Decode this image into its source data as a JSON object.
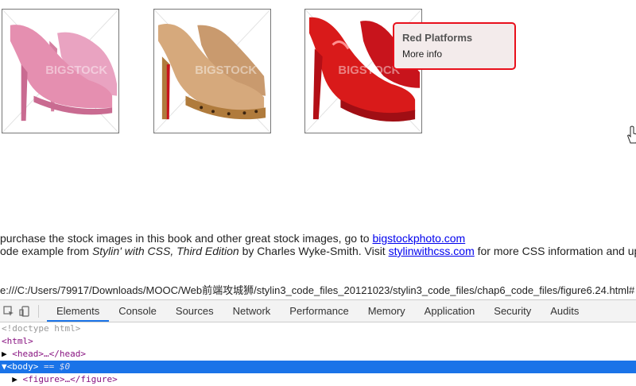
{
  "gallery": {
    "images": [
      {
        "name": "pink-glitter-heels",
        "watermark": "BIGSTOCK",
        "color": "#e58fb0"
      },
      {
        "name": "leopard-platform-heels",
        "watermark": "BIGSTOCK",
        "color": "#d6a97c"
      },
      {
        "name": "red-platform-heels",
        "watermark": "BIGSTOCK",
        "color": "#d91a1a"
      }
    ]
  },
  "popup": {
    "title": "Red Platforms",
    "link": "More info",
    "border_color": "#e8101c"
  },
  "credits": {
    "line1_prefix": "purchase the stock images in this book and other great stock images, go to ",
    "line1_link": "bigstockphoto.com",
    "line2_prefix": "ode example from ",
    "line2_book": "Stylin' with CSS, Third Edition",
    "line2_mid": " by Charles Wyke-Smith. Visit ",
    "line2_link": "stylinwithcss.com",
    "line2_suffix": " for more CSS information and up"
  },
  "address_bar": {
    "url": "e:///C:/Users/79917/Downloads/MOOC/Web前端攻城狮/stylin3_code_files_20121023/stylin3_code_files/chap6_code_files/figure6.24.html#"
  },
  "devtools": {
    "tabs": [
      "Elements",
      "Console",
      "Sources",
      "Network",
      "Performance",
      "Memory",
      "Application",
      "Security",
      "Audits"
    ],
    "active_tab": "Elements",
    "accent": "#1a73e8",
    "dom": {
      "doctype": "<!doctype html>",
      "html_open": "<html>",
      "head": "<head>…</head>",
      "body_open": "<body>",
      "body_marker": " == $0",
      "figure": "<figure>…</figure>"
    }
  }
}
